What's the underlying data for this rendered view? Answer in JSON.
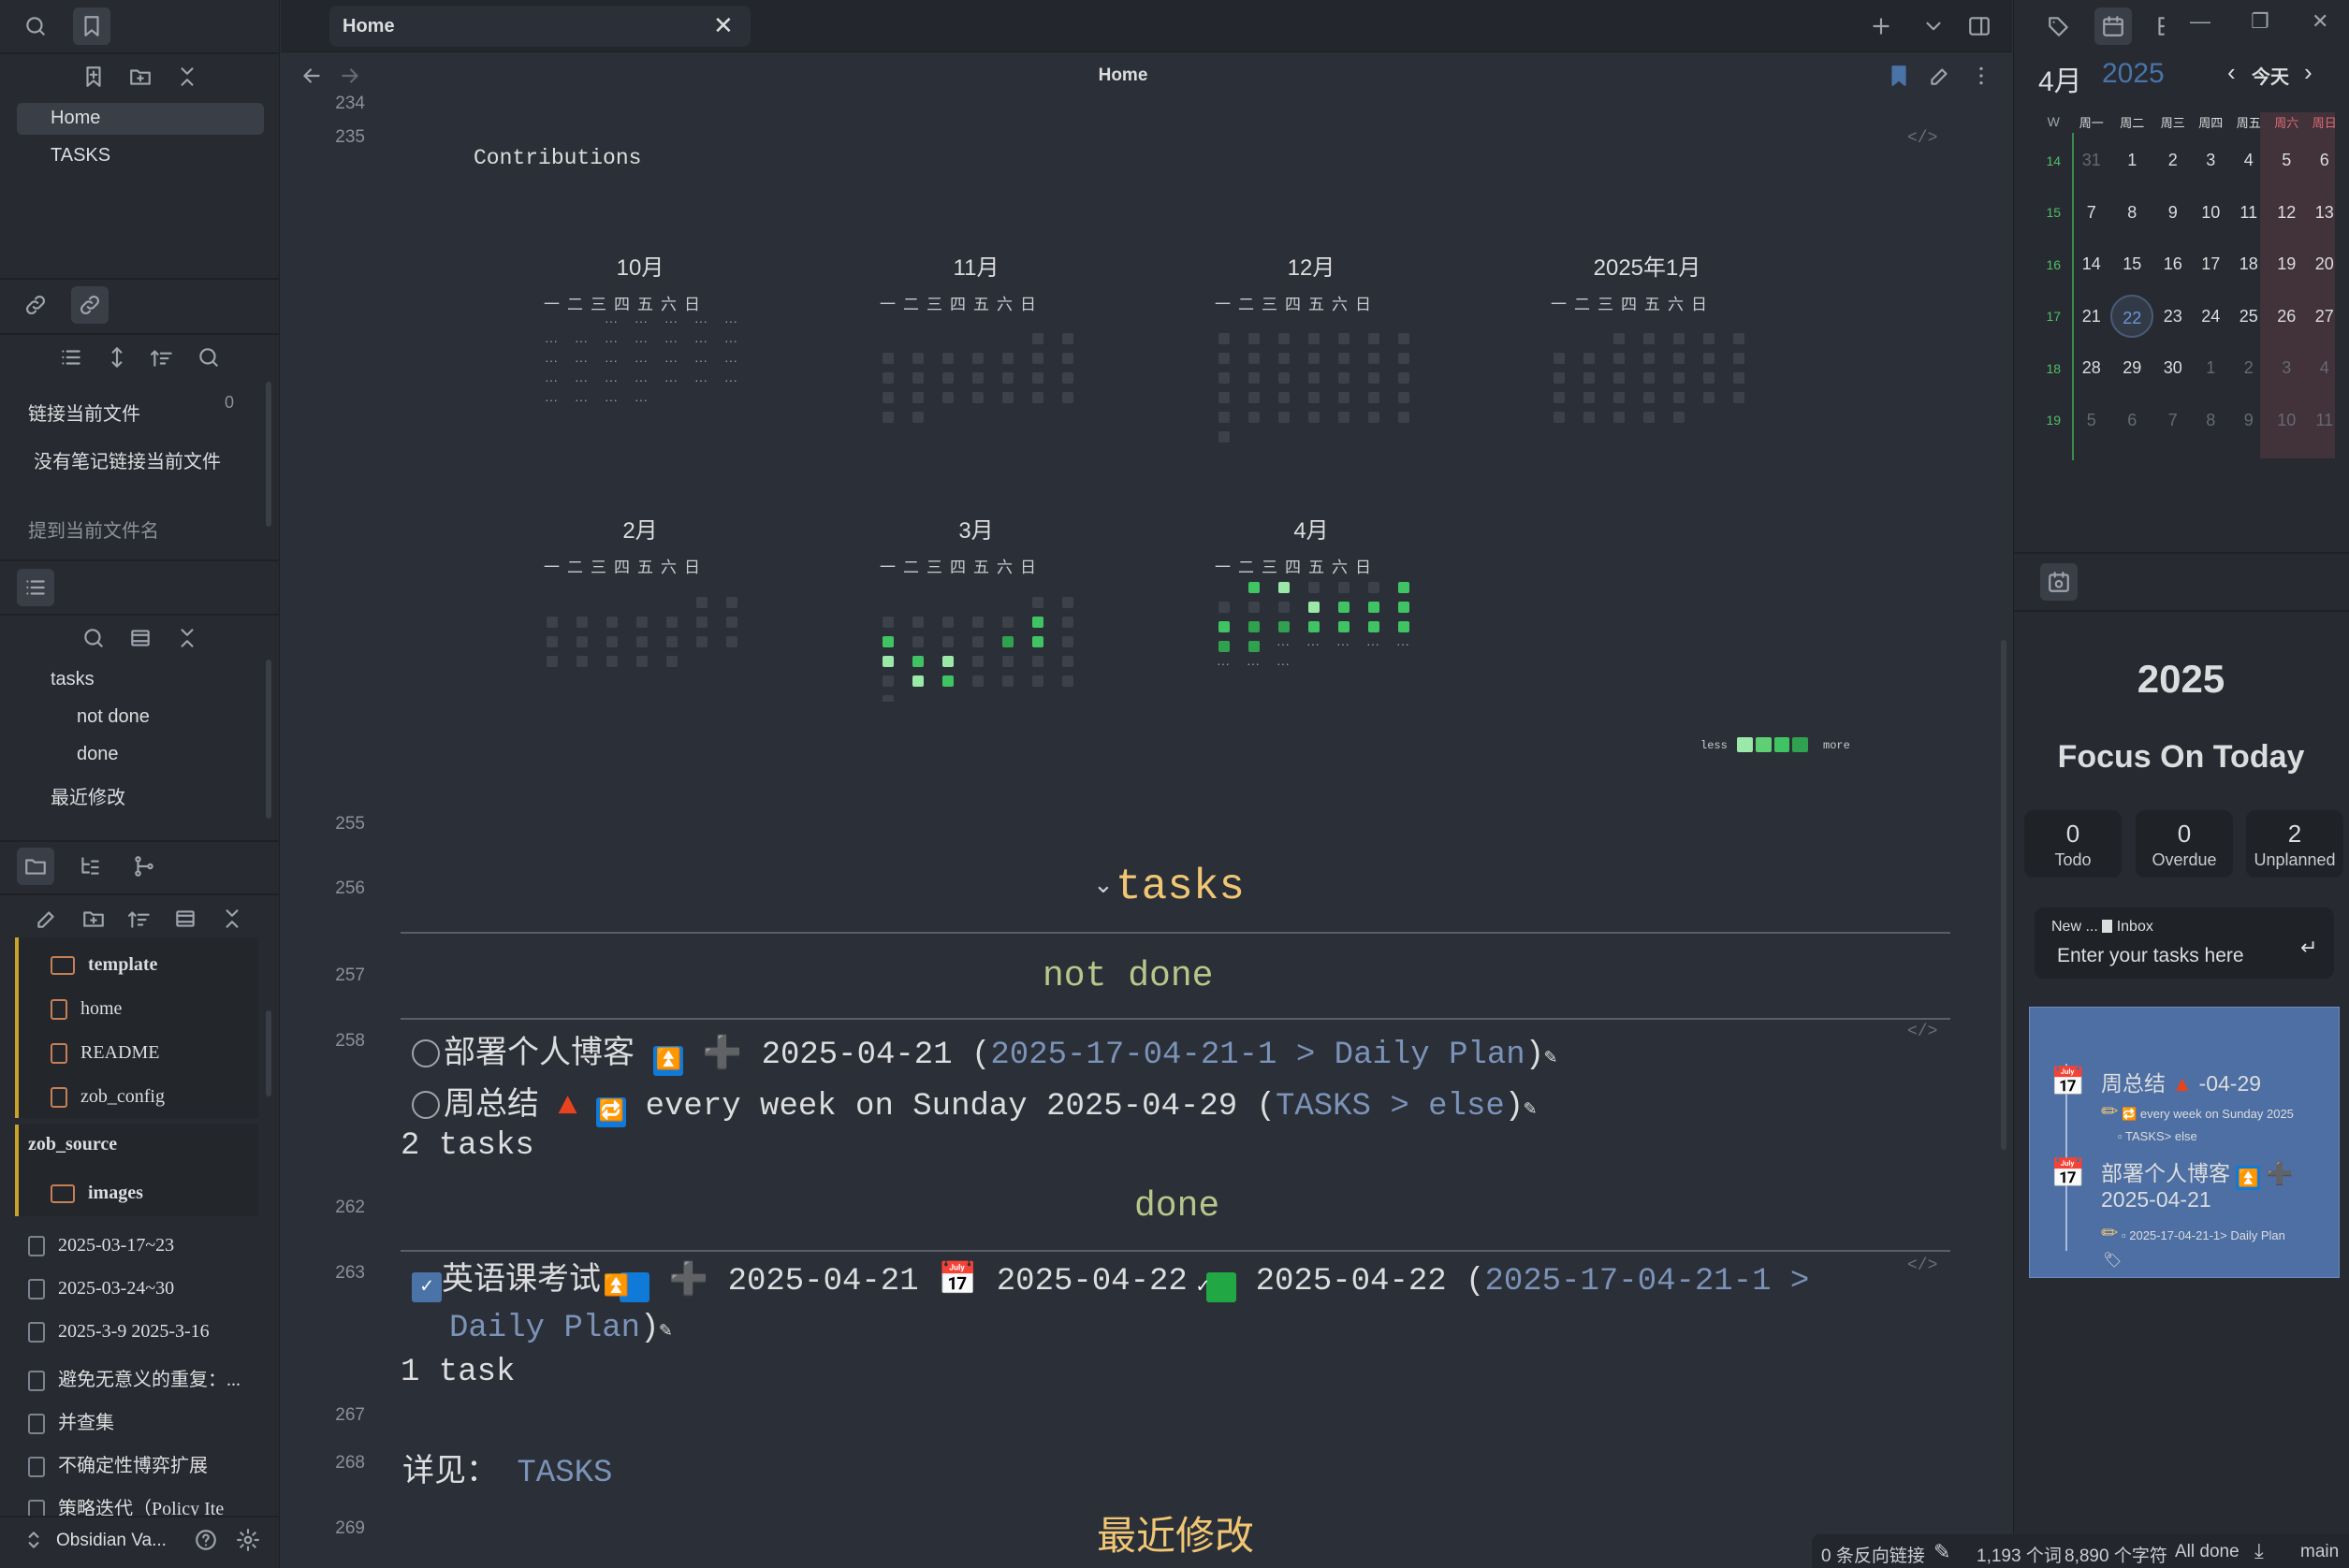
{
  "left": {
    "bookmarks": [
      "Home",
      "TASKS"
    ],
    "backlinks_title": "链接当前文件",
    "backlinks_count": "0",
    "no_backlinks": "没有笔记链接当前文件",
    "mentions": "提到当前文件名",
    "outline": [
      "tasks",
      "not done",
      "done",
      "最近修改"
    ],
    "files": {
      "f1": "template",
      "f2": "home",
      "f3": "README",
      "f4": "zob_config",
      "f5": "zob_source",
      "f6": "images",
      "g1": "2025-03-17~23",
      "g2": "2025-03-24~30",
      "g3": "2025-3-9 2025-3-16",
      "g4": "避免无意义的重复：...",
      "g5": "并查集",
      "g6": "不确定性博弈扩展",
      "g7": "策略迭代（Policy Ite"
    },
    "vault": "Obsidian Va..."
  },
  "tab": {
    "title": "Home"
  },
  "main": {
    "header": "Home",
    "line_numbers": {
      "a": "234",
      "b": "235",
      "c": "255",
      "d": "256",
      "e": "257",
      "f": "258",
      "g": "262",
      "h": "263",
      "i": "267",
      "j": "268",
      "k": "269"
    },
    "contrib_title": "Contributions",
    "months": [
      "10月",
      "11月",
      "12月",
      "2025年1月",
      "2月",
      "3月",
      "4月"
    ],
    "weekdays": "一二三四五六日",
    "legend_less": "less",
    "legend_more": "more",
    "h_tasks": "tasks",
    "h_notdone": "not done",
    "h_done": "done",
    "h_recent": "最近修改",
    "t1": {
      "name": "部署个人博客",
      "date": "2025-04-21 (",
      "link": "2025-17-04-21-1 > Daily Plan",
      ")": ")"
    },
    "t2": {
      "name": "周总结",
      "text": "every week on Sunday 2025-04-29 (",
      "link": "TASKS > else"
    },
    "count1": "2 tasks",
    "t3": {
      "name": "英语课考试",
      "d1": "2025-04-21",
      "d2": "2025-04-22",
      "d3": "2025-04-22 (",
      "link1": "2025-17-04-21-1 > Daily",
      "link2": "Plan"
    },
    "count2": "1 task",
    "see": "详见：",
    "see_link": "TASKS"
  },
  "calendar": {
    "month": "4月",
    "year": "2025",
    "today": "今天",
    "headers": [
      "W",
      "周一",
      "周二",
      "周三",
      "周四",
      "周五",
      "周六",
      "周日"
    ],
    "weeks": [
      [
        "14",
        "31",
        "1",
        "2",
        "3",
        "4",
        "5",
        "6"
      ],
      [
        "15",
        "7",
        "8",
        "9",
        "10",
        "11",
        "12",
        "13"
      ],
      [
        "16",
        "14",
        "15",
        "16",
        "17",
        "18",
        "19",
        "20"
      ],
      [
        "17",
        "21",
        "22",
        "23",
        "24",
        "25",
        "26",
        "27"
      ],
      [
        "18",
        "28",
        "29",
        "30",
        "1",
        "2",
        "3",
        "4"
      ],
      [
        "19",
        "5",
        "6",
        "7",
        "8",
        "9",
        "10",
        "11"
      ]
    ]
  },
  "focus": {
    "year": "2025",
    "title": "Focus On Today",
    "stats": [
      {
        "n": "0",
        "l": "Todo"
      },
      {
        "n": "0",
        "l": "Overdue"
      },
      {
        "n": "2",
        "l": "Unplanned"
      }
    ],
    "new_label": "New ...",
    "inbox": "Inbox",
    "placeholder": "Enter your tasks here",
    "c1": {
      "title": "周总结",
      "date": "-04-29",
      "recur": "every week on Sunday 2025",
      "path": "TASKS> else"
    },
    "c2": {
      "title": "部署个人博客",
      "date": "2025-04-21",
      "path": "2025-17-04-21-1> Daily Plan"
    }
  },
  "status": {
    "backlinks": "0 条反向链接",
    "words": "1,193 个词",
    "chars": "8,890 个字符",
    "done": "All done",
    "branch": "main"
  },
  "colors": {
    "accent": "#4a73a8",
    "green1": "#9be9a8",
    "green2": "#40c463",
    "green3": "#30a14e",
    "heading": "#f0c674",
    "sub": "#b5c88a"
  }
}
